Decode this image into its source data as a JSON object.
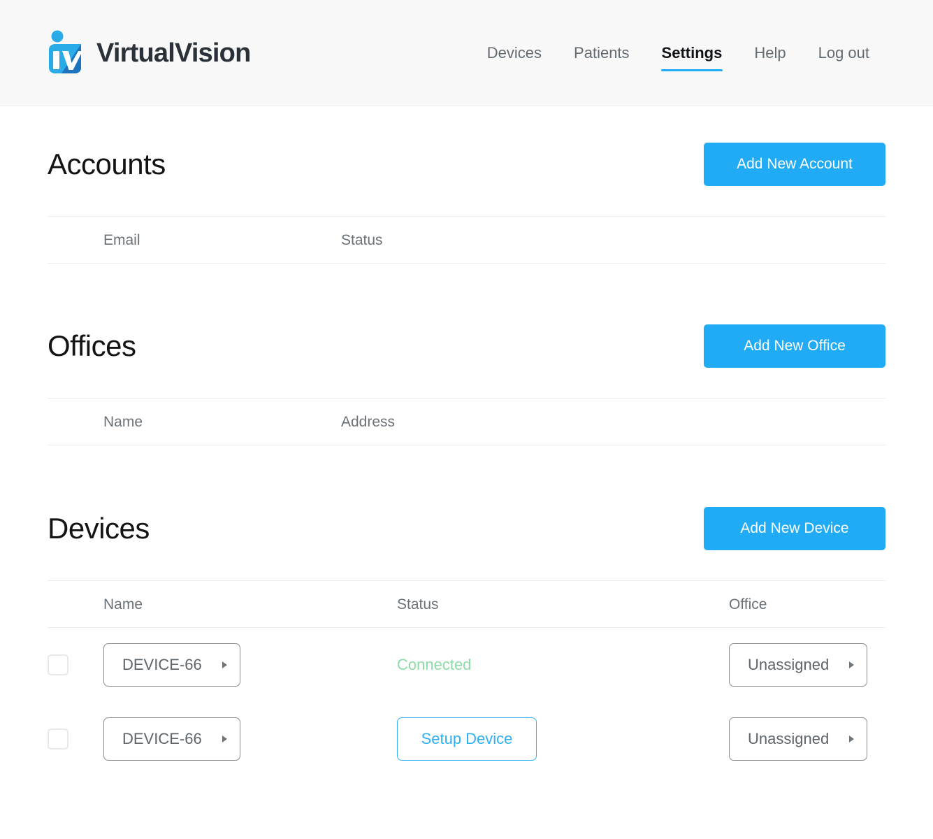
{
  "brand": {
    "name": "VirtualVision",
    "logo_colors": {
      "light": "#29abe8",
      "dark": "#1c75bc",
      "mark": "#ffffff"
    }
  },
  "nav": {
    "items": [
      {
        "label": "Devices",
        "active": false
      },
      {
        "label": "Patients",
        "active": false
      },
      {
        "label": "Settings",
        "active": true
      },
      {
        "label": "Help",
        "active": false
      },
      {
        "label": "Log out",
        "active": false
      }
    ],
    "active_underline_color": "#21abf5"
  },
  "theme": {
    "primary": "#21abf5",
    "header_bg": "#f8f8f8",
    "status_connected": "#8ddba6",
    "text_muted": "#6a7177"
  },
  "sections": {
    "accounts": {
      "title": "Accounts",
      "action_label": "Add New Account",
      "columns": [
        "Email",
        "Status"
      ],
      "rows": []
    },
    "offices": {
      "title": "Offices",
      "action_label": "Add New Office",
      "columns": [
        "Name",
        "Address"
      ],
      "rows": []
    },
    "devices": {
      "title": "Devices",
      "action_label": "Add New Device",
      "columns": [
        "Name",
        "Status",
        "Office"
      ],
      "rows": [
        {
          "selected": false,
          "name": "DEVICE-66",
          "status_type": "text",
          "status": "Connected",
          "office": "Unassigned"
        },
        {
          "selected": false,
          "name": "DEVICE-66",
          "status_type": "button",
          "status": "Setup Device",
          "office": "Unassigned"
        }
      ]
    }
  }
}
